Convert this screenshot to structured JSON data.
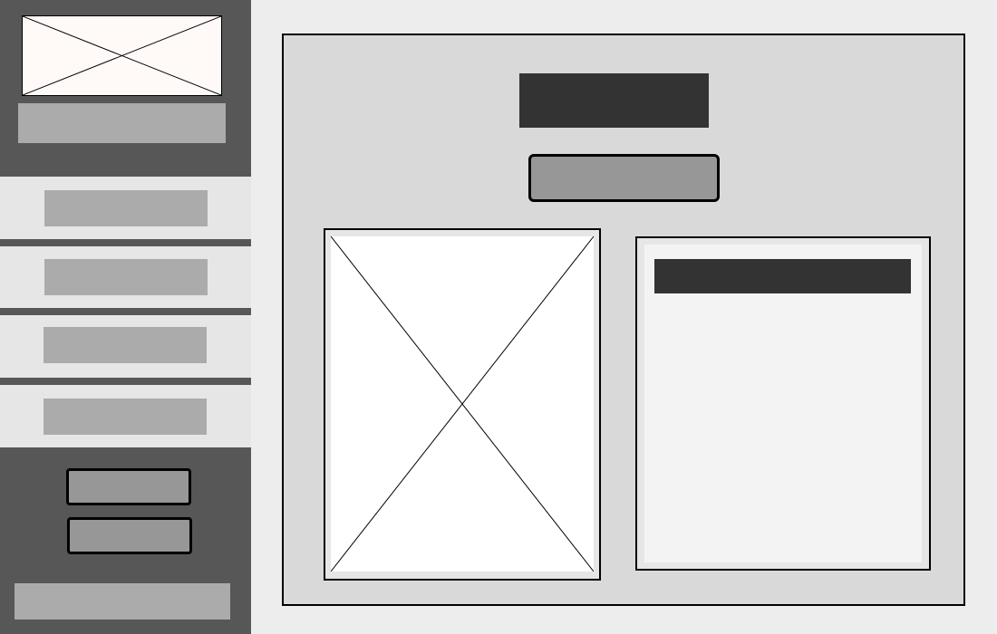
{
  "colors": {
    "page_background": "#ededed",
    "sidebar_dark": "#575757",
    "sidebar_nav_light": "#e6e6e6",
    "placeholder_gray": "#ababab",
    "button_gray": "#979797",
    "main_panel": "#d9d9d9",
    "dark_block": "#333333",
    "details_inner": "#f3f3f3",
    "logo_fill": "#fffaf8",
    "image_fill": "#ffffff",
    "outline": "#000000"
  },
  "sidebar": {
    "logo_icon": "image-placeholder-icon",
    "nav_items": [
      "item-1",
      "item-2",
      "item-3",
      "item-4"
    ],
    "buttons": [
      "button-1",
      "button-2"
    ]
  },
  "main": {
    "image_icon": "image-placeholder-icon"
  }
}
